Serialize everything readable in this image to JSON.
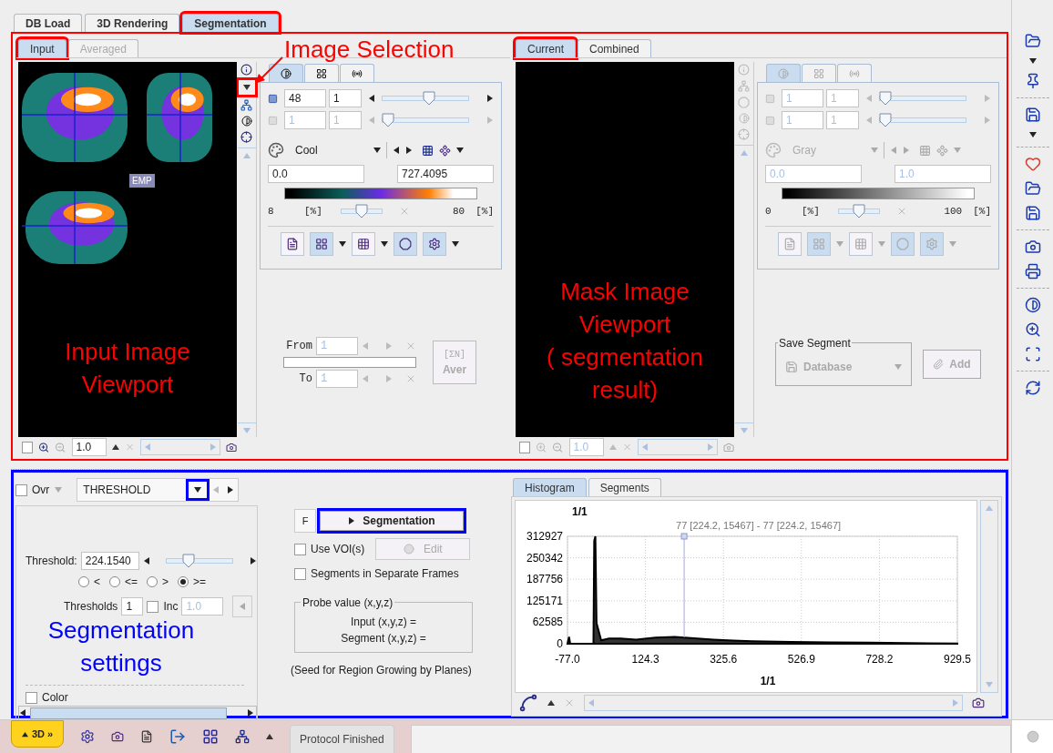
{
  "main_tabs": [
    {
      "label": "DB Load",
      "selected": false,
      "highlighted": false
    },
    {
      "label": "3D Rendering",
      "selected": false,
      "highlighted": false
    },
    {
      "label": "Segmentation",
      "selected": true,
      "highlighted": true
    }
  ],
  "image_selection_annotation": "Image Selection",
  "input_panel": {
    "tabs": [
      {
        "label": "Input",
        "selected": true,
        "disabled": false,
        "highlighted": true
      },
      {
        "label": "Averaged",
        "selected": false,
        "disabled": true,
        "highlighted": false
      }
    ],
    "image_label": "EMP",
    "annotation": "Input Image\nViewport",
    "zoom": "1.0",
    "disabled": false,
    "view_checkbox": {
      "checked": false
    },
    "image_selector_highlighted": true,
    "controls": {
      "disabled": false,
      "tabs": [
        {
          "selected": true
        },
        {
          "selected": false
        },
        {
          "selected": false
        }
      ],
      "frame": {
        "value": "48",
        "step": "1",
        "level": 0.55,
        "disabled": false
      },
      "slice": {
        "value": "1",
        "step": "1",
        "level": 0,
        "disabled": true
      },
      "colormap": "Cool",
      "min": "0.0",
      "max": "727.4095",
      "lower": "8",
      "upper": "80",
      "unit": "[%]",
      "range": {
        "level": 0.5
      }
    },
    "average": {
      "disabled": true,
      "from_label": "From",
      "from": "1",
      "to_label": "To",
      "to": "1",
      "button_symbol": "[ΣN]",
      "button": "Aver"
    }
  },
  "mask_panel": {
    "tabs": [
      {
        "label": "Current",
        "selected": true,
        "disabled": false,
        "highlighted": true
      },
      {
        "label": "Combined",
        "selected": false,
        "disabled": false,
        "highlighted": false
      }
    ],
    "annotation": "Mask Image\nViewport\n( segmentation\nresult)",
    "zoom": "1.0",
    "disabled": true,
    "view_checkbox": {
      "checked": false
    },
    "controls": {
      "disabled": true,
      "tabs": [
        {
          "selected": true
        },
        {
          "selected": false
        },
        {
          "selected": false
        }
      ],
      "frame": {
        "value": "1",
        "step": "1",
        "level": 0,
        "disabled": true
      },
      "slice": {
        "value": "1",
        "step": "1",
        "level": 0,
        "disabled": true
      },
      "colormap": "Gray",
      "min": "0.0",
      "max": "1.0",
      "lower": "0",
      "upper": "100",
      "unit": "[%]",
      "range": {
        "level": 0.5
      }
    },
    "save_segment": {
      "title": "Save Segment",
      "target": "Database",
      "button": "Add",
      "disabled": true
    }
  },
  "segmentation_settings": {
    "overlay": {
      "label": "Ovr",
      "checked": false
    },
    "method": "THRESHOLD",
    "method_highlighted": true,
    "threshold_label": "Threshold:",
    "threshold": "224.1540",
    "threshold_slider": {
      "level": 0.3
    },
    "comparisons": [
      {
        "label": "<",
        "selected": false
      },
      {
        "label": "<=",
        "selected": false
      },
      {
        "label": ">",
        "selected": false
      },
      {
        "label": ">=",
        "selected": true
      }
    ],
    "thresholds_label": "Thresholds",
    "thresholds": "1",
    "increment": {
      "label": "Inc",
      "checked": false,
      "value": "1.0"
    },
    "annotation": "Segmentation\nsettings",
    "color": {
      "label": "Color",
      "checked": false
    }
  },
  "actions": {
    "frame_button": "F",
    "segment_button": "Segmentation",
    "segment_highlighted": true,
    "use_vois": {
      "label": "Use VOI(s)",
      "checked": false
    },
    "edit_button": {
      "label": "Edit",
      "disabled": true
    },
    "separate_frames": {
      "label": "Segments in Separate Frames",
      "checked": false
    },
    "probe": {
      "title": "Probe value (x,y,z)",
      "input": "Input (x,y,z) =",
      "segment": "Segment (x,y,z) ="
    },
    "note": "(Seed for Region Growing by Planes)"
  },
  "histogram": {
    "tabs": [
      {
        "label": "Histogram",
        "selected": true
      },
      {
        "label": "Segments",
        "selected": false
      }
    ],
    "chart_data": {
      "type": "area",
      "title": "1/1",
      "xlabel": "1/1",
      "grid": true,
      "x": [
        -77,
        -73,
        -70,
        -40,
        -10,
        -8,
        -5,
        -2,
        10,
        30,
        60,
        100,
        150,
        200,
        250,
        300,
        350,
        400,
        500,
        600,
        700,
        800,
        929.5
      ],
      "series": [
        {
          "color": "#000000",
          "values": [
            0,
            20000,
            0,
            0,
            0,
            300000,
            312927,
            60000,
            10000,
            15000,
            15000,
            12000,
            18000,
            20000,
            16000,
            12000,
            9000,
            7000,
            5000,
            4000,
            3000,
            2000,
            1000
          ]
        }
      ],
      "xlim": [
        -77,
        929.5
      ],
      "ylim": [
        0,
        312927
      ],
      "xticks": [
        {
          "value": -77,
          "label": "-77.0"
        },
        {
          "value": 124.3,
          "label": "124.3"
        },
        {
          "value": 325.6,
          "label": "325.6"
        },
        {
          "value": 526.9,
          "label": "526.9"
        },
        {
          "value": 728.2,
          "label": "728.2"
        },
        {
          "value": 929.5,
          "label": "929.5"
        }
      ],
      "yticks": [
        0,
        62585,
        125171,
        187756,
        250342,
        312927
      ],
      "ref_lines": [
        {
          "axis": "x",
          "value": 224.2,
          "color": "#a8a8e0"
        }
      ],
      "annotations": [
        {
          "x": 224.2,
          "y": 312927,
          "text": "77 [224.2, 15467] - 77 [224.2, 15467]"
        }
      ]
    }
  },
  "status_bar": {
    "mode_button": "3D »",
    "protocol": "Protocol Finished"
  }
}
